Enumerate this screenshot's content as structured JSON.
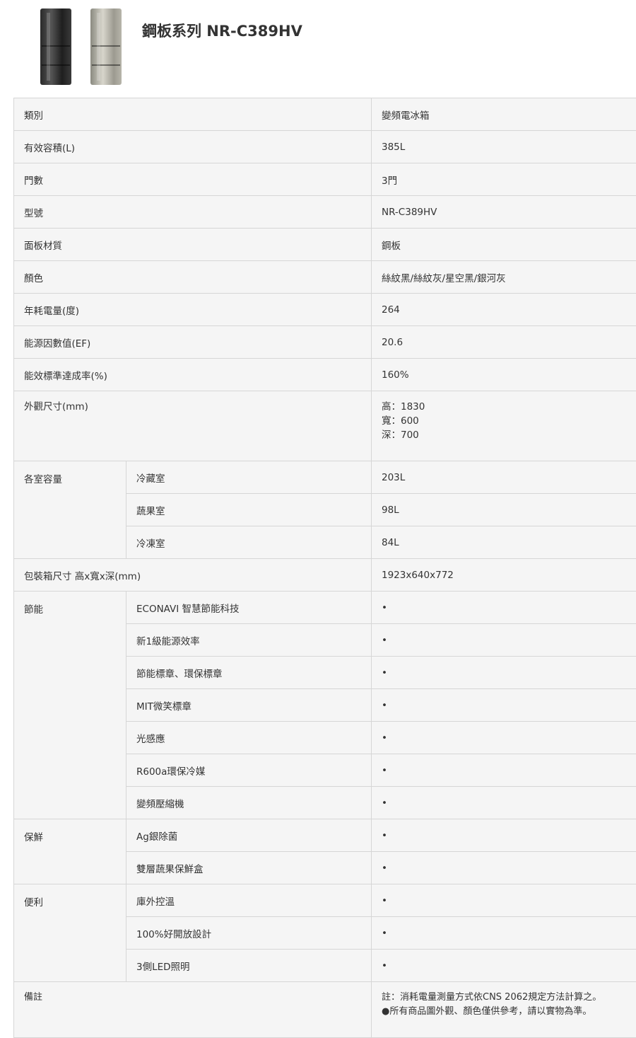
{
  "header": {
    "title": "鋼板系列 NR-C389HV",
    "images": [
      {
        "icon": "refrigerator-black-image",
        "color": "#2f2f2f"
      },
      {
        "icon": "refrigerator-silver-image",
        "color": "#b9b7ad"
      }
    ]
  },
  "specs": {
    "category": {
      "label": "類別",
      "value": "變頻電冰箱"
    },
    "capacity": {
      "label": "有效容積(L)",
      "value": "385L"
    },
    "doors": {
      "label": "門數",
      "value": "3門"
    },
    "model": {
      "label": "型號",
      "value": "NR-C389HV"
    },
    "panel": {
      "label": "面板材質",
      "value": "鋼板"
    },
    "color": {
      "label": "顏色",
      "value": "絲紋黑/絲紋灰/星空黑/銀河灰"
    },
    "annual_power": {
      "label": "年耗電量(度)",
      "value": "264"
    },
    "energy_factor": {
      "label": "能源因數值(EF)",
      "value": "20.6"
    },
    "efficiency_rate": {
      "label": "能效標準達成率(%)",
      "value": "160%"
    },
    "dimensions": {
      "label": "外觀尺寸(mm)",
      "height": "高：1830",
      "width": "寬：600",
      "depth": "深：700"
    },
    "compartments": {
      "label": "各室容量",
      "items": [
        {
          "name": "冷藏室",
          "value": "203L"
        },
        {
          "name": "蔬果室",
          "value": "98L"
        },
        {
          "name": "冷凍室",
          "value": "84L"
        }
      ]
    },
    "package": {
      "label": "包裝箱尺寸 高x寬x深(mm)",
      "value": "1923x640x772"
    },
    "energy_saving": {
      "label": "節能",
      "items": [
        {
          "name": "ECONAVI 智慧節能科技",
          "value": "•"
        },
        {
          "name": "新1級能源效率",
          "value": "•"
        },
        {
          "name": "節能標章、環保標章",
          "value": "•"
        },
        {
          "name": "MIT微笑標章",
          "value": "•"
        },
        {
          "name": "光感應",
          "value": "•"
        },
        {
          "name": "R600a環保冷媒",
          "value": "•"
        },
        {
          "name": "變頻壓縮機",
          "value": "•"
        }
      ]
    },
    "freshness": {
      "label": "保鮮",
      "items": [
        {
          "name": "Ag銀除菌",
          "value": "•"
        },
        {
          "name": "雙層蔬果保鮮盒",
          "value": "•"
        }
      ]
    },
    "convenience": {
      "label": "便利",
      "items": [
        {
          "name": "庫外控溫",
          "value": "•"
        },
        {
          "name": "100%好開放設計",
          "value": "•"
        },
        {
          "name": "3側LED照明",
          "value": "•"
        }
      ]
    },
    "remarks": {
      "label": "備註",
      "line1": "註：消耗電量測量方式依CNS 2062規定方法計算之。",
      "line2": "●所有商品圖外觀、顏色僅供參考，請以實物為準。"
    }
  }
}
